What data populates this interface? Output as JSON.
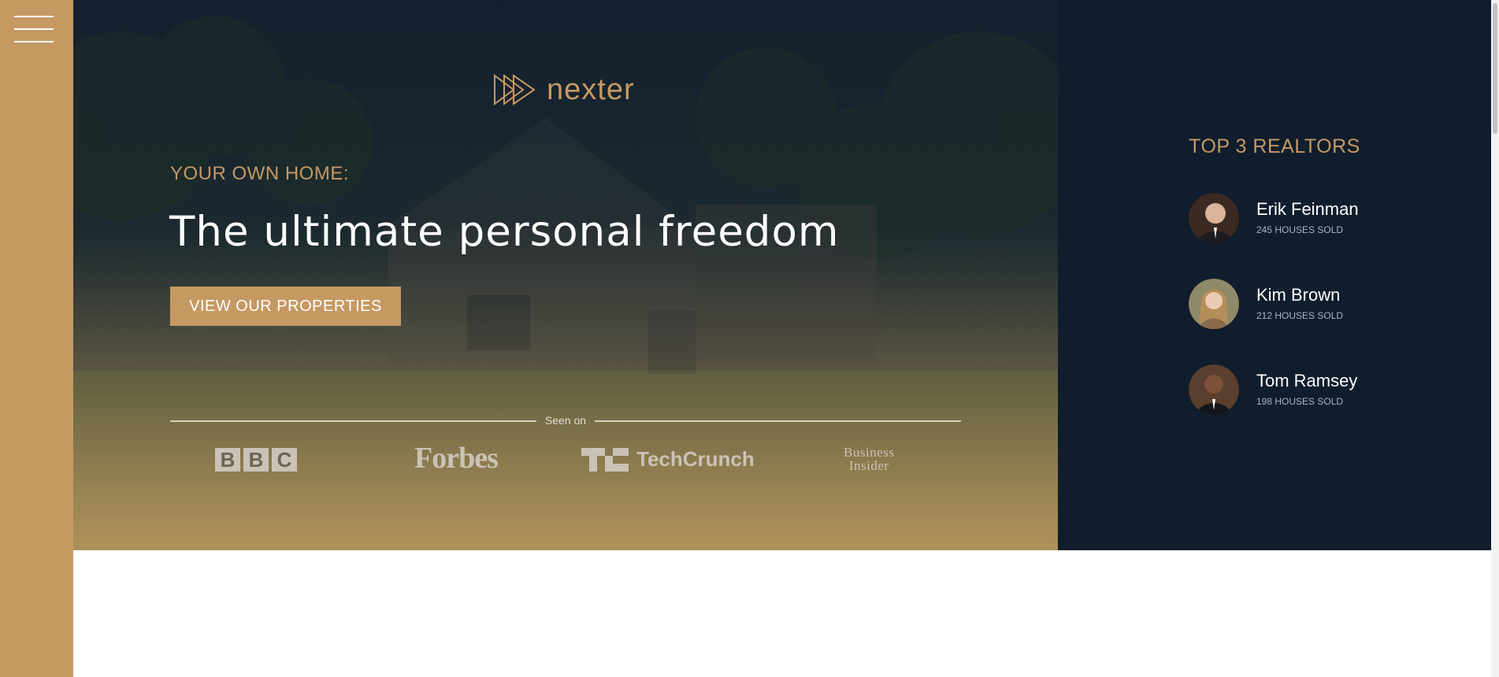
{
  "brand": {
    "name": "nexter",
    "accent": "#c69963",
    "navy": "#101d2c"
  },
  "nav": {
    "menu_icon": "hamburger-icon"
  },
  "hero": {
    "subtitle": "YOUR OWN HOME:",
    "heading": "The ultimate personal freedom",
    "cta_label": "VIEW OUR PROPERTIES",
    "seen_on_label": "Seen on",
    "press": {
      "bbc": [
        "B",
        "B",
        "C"
      ],
      "forbes": "Forbes",
      "techcrunch": "TechCrunch",
      "business_insider": [
        "Business",
        "Insider"
      ]
    }
  },
  "realtors": {
    "title": "TOP 3 REALTORS",
    "items": [
      {
        "name": "Erik Feinman",
        "sold": "245 HOUSES SOLD"
      },
      {
        "name": "Kim Brown",
        "sold": "212 HOUSES SOLD"
      },
      {
        "name": "Tom Ramsey",
        "sold": "198 HOUSES SOLD"
      }
    ]
  }
}
